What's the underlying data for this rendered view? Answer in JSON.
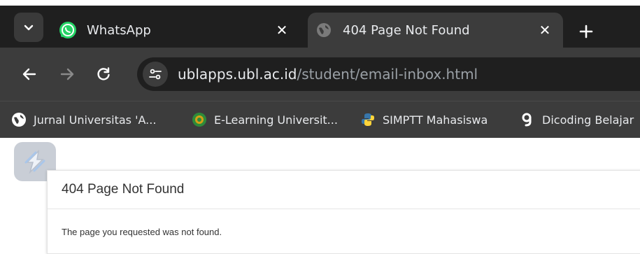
{
  "browser": {
    "tabs": [
      {
        "title": "WhatsApp",
        "favicon": "whatsapp-icon",
        "active": false
      },
      {
        "title": "404 Page Not Found",
        "favicon": "globe-icon",
        "active": true
      }
    ],
    "address_bar": {
      "domain": "ublapps.ubl.ac.id",
      "path": "/student/email-inbox.html"
    },
    "bookmarks": [
      {
        "label": "Jurnal Universitas 'A...",
        "icon": "globe-icon"
      },
      {
        "label": "E-Learning Universit...",
        "icon": "university-logo-icon"
      },
      {
        "label": "SIMPTT Mahasiswa",
        "icon": "python-icon"
      },
      {
        "label": "Dicoding Belajar",
        "icon": "dicoding-icon"
      }
    ]
  },
  "page": {
    "title": "404 Page Not Found",
    "message": "The page you requested was not found."
  },
  "colors": {
    "chrome_dark": "#1f1f1f",
    "chrome_toolbar": "#3c3c3c",
    "whatsapp_green": "#25d366",
    "python_blue": "#3776ab",
    "python_yellow": "#ffd43b",
    "text_light": "#e8eaed",
    "url_muted": "#9aa0a6"
  }
}
